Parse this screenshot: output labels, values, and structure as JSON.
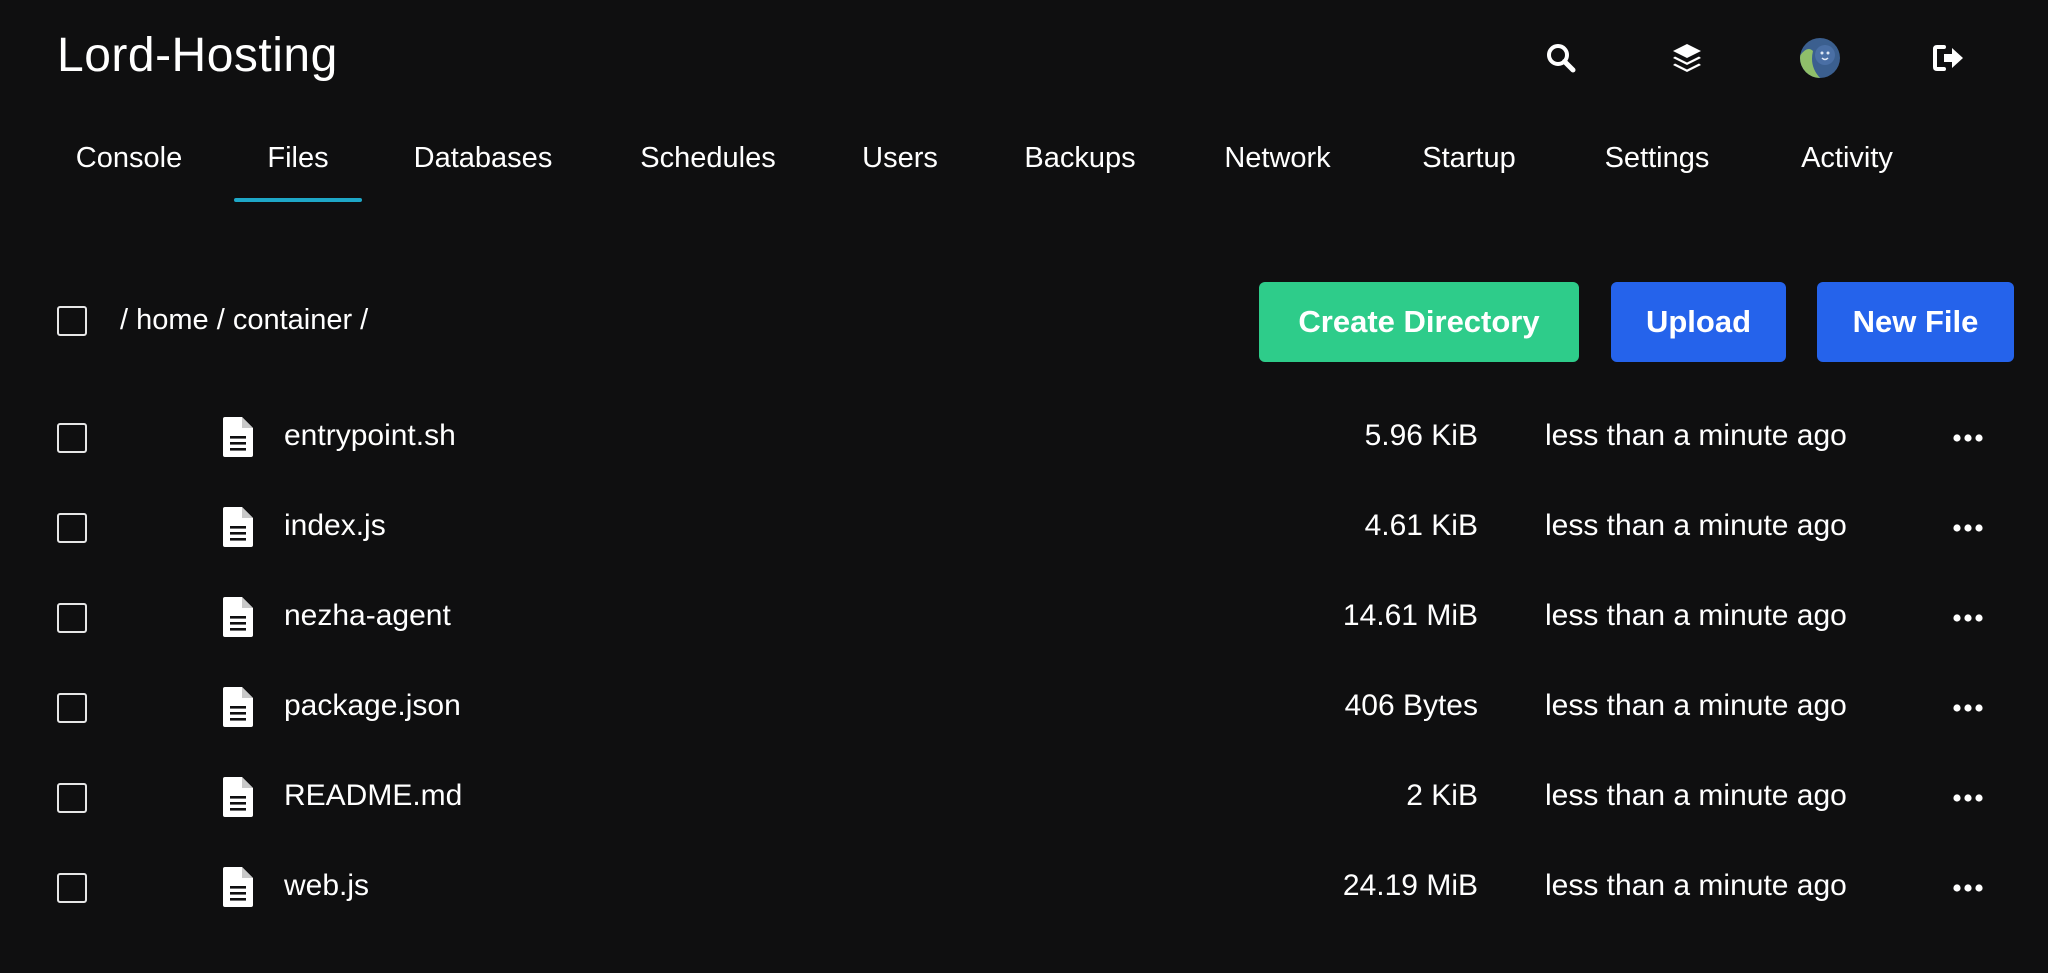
{
  "app": {
    "brand": "Lord-Hosting"
  },
  "header": {
    "icons": [
      "search-icon",
      "layers-icon",
      "avatar",
      "logout-icon"
    ]
  },
  "tabs": [
    {
      "label": "Console",
      "active": false
    },
    {
      "label": "Files",
      "active": true
    },
    {
      "label": "Databases",
      "active": false
    },
    {
      "label": "Schedules",
      "active": false
    },
    {
      "label": "Users",
      "active": false
    },
    {
      "label": "Backups",
      "active": false
    },
    {
      "label": "Network",
      "active": false
    },
    {
      "label": "Startup",
      "active": false
    },
    {
      "label": "Settings",
      "active": false
    },
    {
      "label": "Activity",
      "active": false
    }
  ],
  "toolbar": {
    "breadcrumb": "/ home / container /",
    "create_directory_label": "Create Directory",
    "upload_label": "Upload",
    "new_file_label": "New File"
  },
  "files": [
    {
      "name": "entrypoint.sh",
      "size": "5.96 KiB",
      "modified": "less than a minute ago"
    },
    {
      "name": "index.js",
      "size": "4.61 KiB",
      "modified": "less than a minute ago"
    },
    {
      "name": "nezha-agent",
      "size": "14.61 MiB",
      "modified": "less than a minute ago"
    },
    {
      "name": "package.json",
      "size": "406 Bytes",
      "modified": "less than a minute ago"
    },
    {
      "name": "README.md",
      "size": "2 KiB",
      "modified": "less than a minute ago"
    },
    {
      "name": "web.js",
      "size": "24.19 MiB",
      "modified": "less than a minute ago"
    }
  ],
  "colors": {
    "background": "#0f0f10",
    "tab_underline": "#1ea7c7",
    "create_directory": "#2ecc8a",
    "primary": "#2563eb"
  }
}
